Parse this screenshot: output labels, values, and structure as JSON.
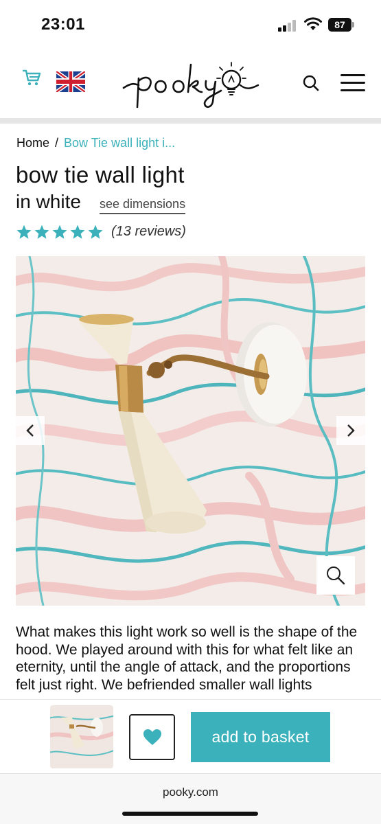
{
  "status_bar": {
    "time": "23:01",
    "battery": "87"
  },
  "header": {
    "logo_text": "pooky",
    "icons": [
      "cart-icon",
      "uk-flag-icon",
      "search-icon",
      "menu-icon"
    ]
  },
  "breadcrumb": {
    "home": "Home",
    "separator": "/",
    "current": "Bow Tie wall light i..."
  },
  "product": {
    "title_line1": "bow tie wall light",
    "title_line2": "in white",
    "see_dimensions": "see dimensions",
    "rating": 5,
    "reviews": "(13 reviews)",
    "description": "What makes this light work so well is the shape of the hood. We played around with this for what felt like an eternity, until the angle of attack, and the proportions felt just right. We befriended smaller wall lights"
  },
  "sticky_bar": {
    "add_to_basket": "add to basket"
  },
  "browser": {
    "url": "pooky.com"
  },
  "colors": {
    "accent": "#3ab1bb",
    "text": "#111111"
  }
}
